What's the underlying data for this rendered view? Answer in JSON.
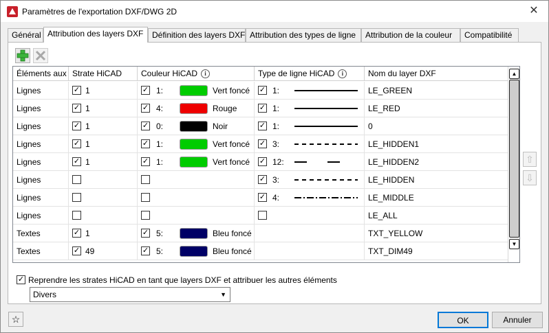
{
  "window": {
    "title": "Paramètres de l'exportation DXF/DWG 2D",
    "close_glyph": "✕"
  },
  "tabs": [
    {
      "label": "Général"
    },
    {
      "label": "Attribution des layers DXF"
    },
    {
      "label": "Définition des layers DXF"
    },
    {
      "label": "Attribution des types de ligne"
    },
    {
      "label": "Attribution de la couleur"
    },
    {
      "label": "Compatibilité"
    }
  ],
  "toolbar": {
    "add_icon": "plus-icon",
    "delete_icon": "delete-x-icon"
  },
  "columns": [
    "Éléments aux",
    "Strate HiCAD",
    "Couleur HiCAD",
    "Type de ligne HiCAD",
    "Nom du layer DXF"
  ],
  "rows": [
    {
      "element": "Lignes",
      "strate_checked": true,
      "strate": "1",
      "color_checked": true,
      "color_num": "1:",
      "color_hex": "#00cc00",
      "color_name": "Vert foncé",
      "lt_checked": true,
      "lt_enabled": true,
      "lt_num": "1:",
      "lt_style": "solid",
      "layer": "LE_GREEN"
    },
    {
      "element": "Lignes",
      "strate_checked": true,
      "strate": "1",
      "color_checked": true,
      "color_num": "4:",
      "color_hex": "#ee0000",
      "color_name": "Rouge",
      "lt_checked": true,
      "lt_enabled": true,
      "lt_num": "1:",
      "lt_style": "solid",
      "layer": "LE_RED"
    },
    {
      "element": "Lignes",
      "strate_checked": true,
      "strate": "1",
      "color_checked": true,
      "color_num": "0:",
      "color_hex": "#000000",
      "color_name": "Noir",
      "lt_checked": true,
      "lt_enabled": true,
      "lt_num": "1:",
      "lt_style": "solid",
      "layer": "0"
    },
    {
      "element": "Lignes",
      "strate_checked": true,
      "strate": "1",
      "color_checked": true,
      "color_num": "1:",
      "color_hex": "#00cc00",
      "color_name": "Vert foncé",
      "lt_checked": true,
      "lt_enabled": true,
      "lt_num": "3:",
      "lt_style": "dashed",
      "layer": "LE_HIDDEN1"
    },
    {
      "element": "Lignes",
      "strate_checked": true,
      "strate": "1",
      "color_checked": true,
      "color_num": "1:",
      "color_hex": "#00cc00",
      "color_name": "Vert foncé",
      "lt_checked": true,
      "lt_enabled": true,
      "lt_num": "12:",
      "lt_style": "longdash",
      "layer": "LE_HIDDEN2"
    },
    {
      "element": "Lignes",
      "strate_checked": false,
      "strate": "",
      "color_checked": false,
      "color_num": "",
      "color_hex": "",
      "color_name": "",
      "lt_checked": true,
      "lt_enabled": true,
      "lt_num": "3:",
      "lt_style": "dashed",
      "layer": "LE_HIDDEN"
    },
    {
      "element": "Lignes",
      "strate_checked": false,
      "strate": "",
      "color_checked": false,
      "color_num": "",
      "color_hex": "",
      "color_name": "",
      "lt_checked": true,
      "lt_enabled": true,
      "lt_num": "4:",
      "lt_style": "dashdot",
      "layer": "LE_MIDDLE"
    },
    {
      "element": "Lignes",
      "strate_checked": false,
      "strate": "",
      "color_checked": false,
      "color_num": "",
      "color_hex": "",
      "color_name": "",
      "lt_checked": false,
      "lt_enabled": true,
      "lt_num": "",
      "lt_style": "",
      "layer": "LE_ALL"
    },
    {
      "element": "Textes",
      "strate_checked": true,
      "strate": "1",
      "color_checked": true,
      "color_num": "5:",
      "color_hex": "#000066",
      "color_name": "Bleu foncé",
      "lt_checked": false,
      "lt_enabled": false,
      "lt_num": "",
      "lt_style": "",
      "layer": "TXT_YELLOW"
    },
    {
      "element": "Textes",
      "strate_checked": true,
      "strate": "49",
      "color_checked": true,
      "color_num": "5:",
      "color_hex": "#000066",
      "color_name": "Bleu foncé",
      "lt_checked": false,
      "lt_enabled": false,
      "lt_num": "",
      "lt_style": "",
      "layer": "TXT_DIM49"
    }
  ],
  "options": {
    "reprendre_checked": true,
    "reprendre_label": "Reprendre les strates HiCAD en tant que layers DXF et attribuer les autres éléments",
    "combo_value": "Divers"
  },
  "buttons": {
    "ok": "OK",
    "cancel": "Annuler"
  }
}
